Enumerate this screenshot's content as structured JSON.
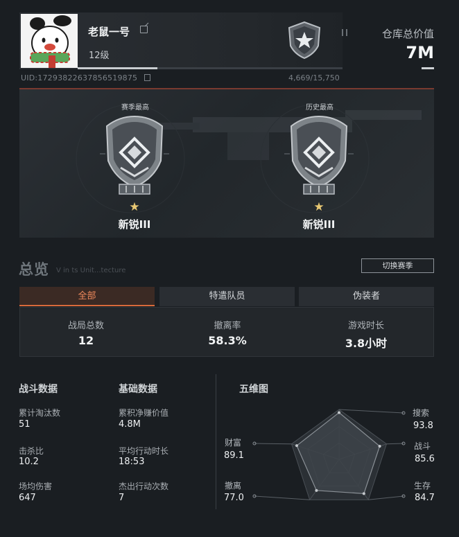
{
  "profile": {
    "name": "老鼠一号",
    "level": "12级",
    "uid": "UID:17293822637856519875",
    "xp": "4,669/15,750",
    "level_progress": 0.3
  },
  "warehouse": {
    "label": "仓库总价值",
    "value": "7M"
  },
  "ranks": {
    "season": {
      "label": "赛季最高",
      "name": "新锐III"
    },
    "history": {
      "label": "历史最高",
      "name": "新锐III"
    }
  },
  "overview": {
    "title": "总览",
    "subtitle": "V in ts Unit...tecture",
    "switch_season": "切换赛季",
    "tabs": [
      {
        "label": "全部",
        "active": true
      },
      {
        "label": "特遣队员",
        "active": false
      },
      {
        "label": "伪装者",
        "active": false
      }
    ],
    "stats": [
      {
        "label": "战局总数",
        "value": "12"
      },
      {
        "label": "撤离率",
        "value": "58.3%"
      },
      {
        "label": "游戏时长",
        "value": "3.8小时"
      }
    ]
  },
  "combat": {
    "title": "战斗数据",
    "items": [
      {
        "label": "累计淘汰数",
        "value": "51"
      },
      {
        "label": "击杀比",
        "value": "10.2"
      },
      {
        "label": "场均伤害",
        "value": "647"
      }
    ]
  },
  "basic": {
    "title": "基础数据",
    "items": [
      {
        "label": "累积净赚价值",
        "value": "4.8M"
      },
      {
        "label": "平均行动时长",
        "value": "18:53"
      },
      {
        "label": "杰出行动次数",
        "value": "7"
      }
    ]
  },
  "radar": {
    "title": "五维图",
    "axes": [
      {
        "label": "搜索",
        "value": "93.8",
        "score": 93.8
      },
      {
        "label": "战斗",
        "value": "85.6",
        "score": 85.6
      },
      {
        "label": "生存",
        "value": "84.7",
        "score": 84.7
      },
      {
        "label": "撤离",
        "value": "77.0",
        "score": 77.0
      },
      {
        "label": "财富",
        "value": "89.1",
        "score": 89.1
      }
    ]
  },
  "colors": {
    "accent": "#d96a3b",
    "star": "#e8c873",
    "radar_fill": "#3d4349"
  }
}
